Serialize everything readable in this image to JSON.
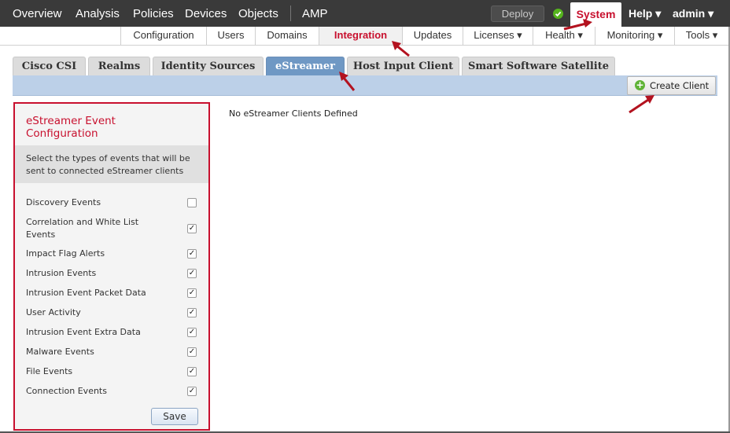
{
  "topnav": {
    "items": [
      "Overview",
      "Analysis",
      "Policies",
      "Devices",
      "Objects",
      "AMP"
    ],
    "deploy_label": "Deploy",
    "system_label": "System",
    "help_label": "Help ▾",
    "user_label": "admin ▾"
  },
  "subnav": {
    "items": [
      "Configuration",
      "Users",
      "Domains",
      "Integration",
      "Updates",
      "Licenses ▾",
      "Health ▾",
      "Monitoring ▾",
      "Tools ▾"
    ],
    "active": "Integration"
  },
  "tabs": {
    "items": [
      "Cisco CSI",
      "Realms",
      "Identity Sources",
      "eStreamer",
      "Host Input Client",
      "Smart Software Satellite"
    ],
    "active": "eStreamer"
  },
  "toolbar": {
    "create_client_label": "Create Client"
  },
  "panel": {
    "title": "eStreamer Event Configuration",
    "description": "Select the types of events that will be sent to connected eStreamer clients",
    "events": [
      {
        "label": "Discovery Events",
        "checked": false
      },
      {
        "label": "Correlation and White List Events",
        "checked": true
      },
      {
        "label": "Impact Flag Alerts",
        "checked": true
      },
      {
        "label": "Intrusion Events",
        "checked": true
      },
      {
        "label": "Intrusion Event Packet Data",
        "checked": true
      },
      {
        "label": "User Activity",
        "checked": true
      },
      {
        "label": "Intrusion Event Extra Data",
        "checked": true
      },
      {
        "label": "Malware Events",
        "checked": true
      },
      {
        "label": "File Events",
        "checked": true
      },
      {
        "label": "Connection Events",
        "checked": true
      }
    ],
    "save_label": "Save"
  },
  "main": {
    "empty_message": "No eStreamer Clients Defined"
  },
  "colors": {
    "accent": "#c8102e",
    "active_tab": "#6f98c4",
    "topnav_bg": "#3a3a3a",
    "toolbar_bg": "#bcd0e8",
    "status_ok": "#56b41e"
  },
  "icons": {
    "status": "check-circle-icon",
    "create": "plus-circle-icon",
    "checkbox": "checkmark-icon"
  }
}
